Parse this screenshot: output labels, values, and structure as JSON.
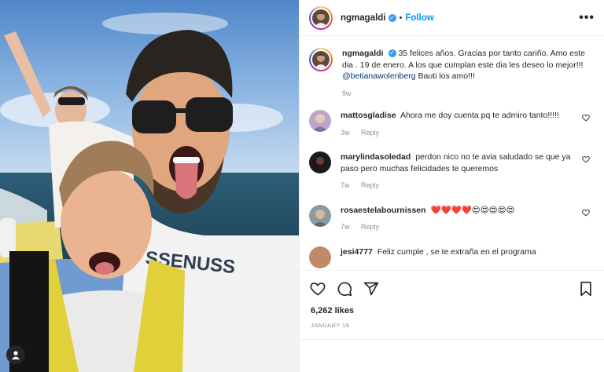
{
  "post": {
    "username": "ngmagaldi",
    "follow_label": "Follow",
    "more_label": "•••",
    "likes": "6,262 likes",
    "date": "January 19"
  },
  "caption": {
    "username": "ngmagaldi",
    "text": "35 felices años. Gracias por tanto cariño. Amo este dia . 19 de enero. A los que cumplan este dia les deseo lo mejor!!!",
    "mention": "@betianawolenberg",
    "text_after": " Bauti los amo!!!",
    "time": "9w"
  },
  "comments": [
    {
      "username": "mattosgladise",
      "text": "Ahora me doy cuenta pq te admiro tanto!!!!!",
      "time": "3w",
      "reply": "Reply",
      "avatar_color": "#b9a6c8"
    },
    {
      "username": "marylindasoledad",
      "text": "perdon nico no te avia saludado se que ya paso pero muchas felicidades te queremos",
      "time": "7w",
      "reply": "Reply",
      "avatar_color": "#1a1a1a"
    },
    {
      "username": "rosaestelabournissen",
      "text": "❤️❤️❤️❤️😍😍😍😍😍",
      "time": "7w",
      "reply": "Reply",
      "avatar_color": "#8a9aa3"
    },
    {
      "username": "jesi4777",
      "text": "Feliz cumple , se te extraña en el programa",
      "time": "",
      "reply": "",
      "avatar_color": "#c08a6a"
    }
  ],
  "icons": {
    "heart": "heart-icon",
    "comment": "comment-icon",
    "share": "share-icon",
    "save": "bookmark-icon",
    "user_tag": "user-tag-icon",
    "verified": "verified-badge-icon"
  },
  "colors": {
    "accent": "#0095f6",
    "verified": "#3897f0",
    "mention": "#00376b",
    "muted": "#8e8e8e"
  }
}
